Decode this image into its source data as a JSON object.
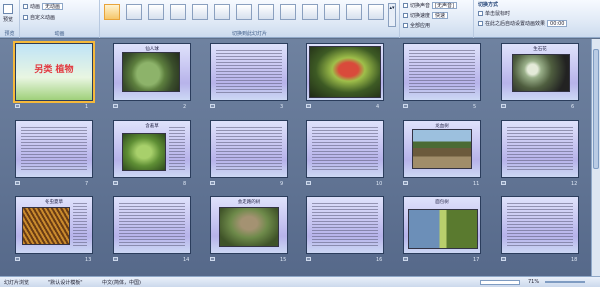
{
  "ribbon": {
    "groups": [
      "预览",
      "动画",
      "切换到此幻灯片",
      "切换方式"
    ],
    "preview_label": "预览",
    "animate_label": "动画",
    "animate_value": "无动画",
    "custom_anim_label": "自定义动画",
    "switch_sound_label": "切换声音",
    "switch_sound_value": "[无声音]",
    "switch_speed_label": "切换速度",
    "switch_speed_value": "快速",
    "apply_all_label": "全部应用",
    "on_click_label": "单击鼠标时",
    "auto_after_label": "在此之后自动设置动画效果",
    "auto_after_value": "00:00"
  },
  "slides": [
    {
      "num": "1",
      "title": "另类 植物",
      "kind": "cover"
    },
    {
      "num": "2",
      "title": "仙人球",
      "kind": "cactus"
    },
    {
      "num": "3",
      "title": "",
      "kind": "text"
    },
    {
      "num": "4",
      "title": "",
      "kind": "flytrap"
    },
    {
      "num": "5",
      "title": "",
      "kind": "text"
    },
    {
      "num": "6",
      "title": "生石花",
      "kind": "stones"
    },
    {
      "num": "7",
      "title": "",
      "kind": "text"
    },
    {
      "num": "8",
      "title": "含羞草",
      "kind": "mimosa"
    },
    {
      "num": "9",
      "title": "",
      "kind": "text"
    },
    {
      "num": "10",
      "title": "",
      "kind": "text"
    },
    {
      "num": "11",
      "title": "龙血树",
      "kind": "dragontree"
    },
    {
      "num": "12",
      "title": "",
      "kind": "text"
    },
    {
      "num": "13",
      "title": "冬虫夏草",
      "kind": "cordyceps"
    },
    {
      "num": "14",
      "title": "",
      "kind": "text"
    },
    {
      "num": "15",
      "title": "会走路的树",
      "kind": "walkingtree"
    },
    {
      "num": "16",
      "title": "",
      "kind": "text"
    },
    {
      "num": "17",
      "title": "面包树",
      "kind": "breadtree"
    },
    {
      "num": "18",
      "title": "",
      "kind": "text"
    }
  ],
  "status": {
    "view": "幻灯片浏览",
    "theme": "\"默认设计模板\"",
    "language": "中文(简体，中国)",
    "zoom": "71%"
  }
}
